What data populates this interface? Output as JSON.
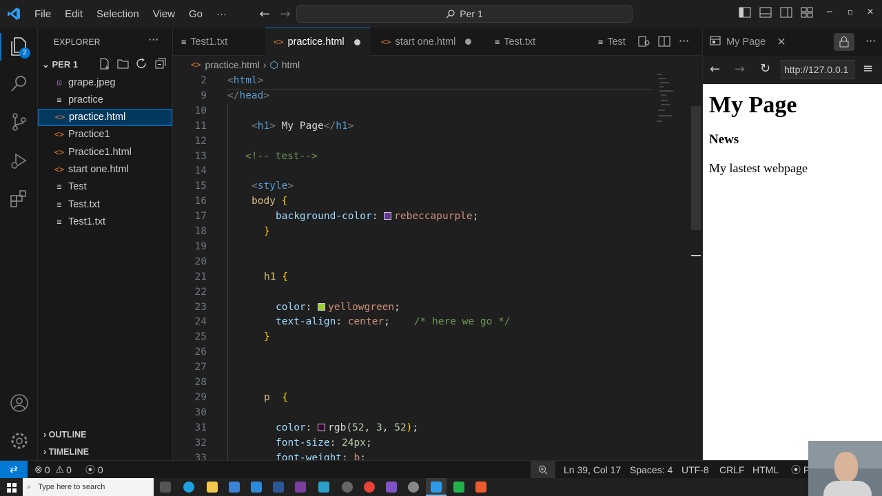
{
  "menu": {
    "items": [
      "File",
      "Edit",
      "Selection",
      "View",
      "Go",
      "···"
    ]
  },
  "command_center": {
    "label": "Per 1"
  },
  "activity_badge": "2",
  "explorer": {
    "title": "EXPLORER",
    "folder": "PER 1",
    "files": [
      {
        "name": "grape.jpeg",
        "type": "img"
      },
      {
        "name": "practice",
        "type": "txt"
      },
      {
        "name": "practice.html",
        "type": "html",
        "selected": true
      },
      {
        "name": "Practice1",
        "type": "html"
      },
      {
        "name": "Practice1.html",
        "type": "html"
      },
      {
        "name": "start one.html",
        "type": "html"
      },
      {
        "name": "Test",
        "type": "txt"
      },
      {
        "name": "Test.txt",
        "type": "txt"
      },
      {
        "name": "Test1.txt",
        "type": "txt"
      }
    ],
    "outline": "OUTLINE",
    "timeline": "TIMELINE"
  },
  "tabs": [
    {
      "label": "Test1.txt",
      "icon": "txt"
    },
    {
      "label": "practice.html",
      "icon": "html",
      "active": true,
      "dirty": true
    },
    {
      "label": "start one.html",
      "icon": "html",
      "dirty": true
    },
    {
      "label": "Test.txt",
      "icon": "txt"
    },
    {
      "label": "Test",
      "icon": "txt"
    }
  ],
  "breadcrumb": {
    "file": "practice.html",
    "symbol": "html"
  },
  "code_lines": [
    {
      "n": "2",
      "text": "<html>"
    },
    {
      "n": "9",
      "text": "</head>"
    },
    {
      "n": "10",
      "text": ""
    },
    {
      "n": "11",
      "text": "<h1> My Page</h1>"
    },
    {
      "n": "12",
      "text": ""
    },
    {
      "n": "13",
      "text": "<!-- test-->"
    },
    {
      "n": "14",
      "text": ""
    },
    {
      "n": "15",
      "text": "<style>"
    },
    {
      "n": "16",
      "text": "body {"
    },
    {
      "n": "17",
      "text": "background-color: rebeccapurple;"
    },
    {
      "n": "18",
      "text": "}"
    },
    {
      "n": "19",
      "text": ""
    },
    {
      "n": "20",
      "text": ""
    },
    {
      "n": "21",
      "text": "h1 {"
    },
    {
      "n": "22",
      "text": ""
    },
    {
      "n": "23",
      "text": "color: yellowgreen;"
    },
    {
      "n": "24",
      "text": "text-align: center;    /* here we go */"
    },
    {
      "n": "25",
      "text": "}"
    },
    {
      "n": "26",
      "text": ""
    },
    {
      "n": "27",
      "text": ""
    },
    {
      "n": "28",
      "text": ""
    },
    {
      "n": "29",
      "text": "p  {"
    },
    {
      "n": "30",
      "text": ""
    },
    {
      "n": "31",
      "text": "color: rgb(52, 3, 52);"
    },
    {
      "n": "32",
      "text": "font-size: 24px;"
    },
    {
      "n": "33",
      "text": "font-weight: b;"
    }
  ],
  "colors": {
    "rebeccapurple": "#663399",
    "yellowgreen": "#9acd32",
    "rgb_52_3_52": "#340334",
    "accent": "#0078d4"
  },
  "preview": {
    "tab_label": "My Page",
    "url": "http://127.0.0.1",
    "h1": "My Page",
    "h3": "News",
    "p": "My lastest webpage"
  },
  "status": {
    "errors": "0",
    "warnings": "0",
    "ports": "0",
    "position": "Ln 39, Col 17",
    "spaces": "Spaces: 4",
    "encoding": "UTF-8",
    "eol": "CRLF",
    "language": "HTML",
    "extra": "P"
  },
  "taskbar": {
    "search_placeholder": "Type here to search"
  }
}
